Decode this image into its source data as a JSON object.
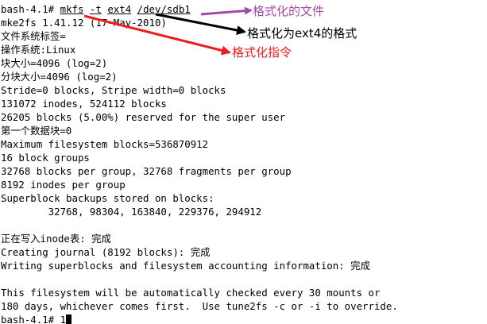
{
  "terminal": {
    "prompt": "bash-4.1# ",
    "command": {
      "program": "mkfs",
      "option": "-t",
      "fstype": "ext4",
      "device": "/dev/sdb1"
    },
    "lines": [
      "mke2fs 1.41.12 (17-May-2010)",
      "文件系统标签=",
      "操作系统:Linux",
      "块大小=4096 (log=2)",
      "分块大小=4096 (log=2)",
      "Stride=0 blocks, Stripe width=0 blocks",
      "131072 inodes, 524112 blocks",
      "26205 blocks (5.00%) reserved for the super user",
      "第一个数据块=0",
      "Maximum filesystem blocks=536870912",
      "16 block groups",
      "32768 blocks per group, 32768 fragments per group",
      "8192 inodes per group",
      "Superblock backups stored on blocks:",
      "        32768, 98304, 163840, 229376, 294912",
      "",
      "正在写入inode表: 完成",
      "Creating journal (8192 blocks): 完成",
      "Writing superblocks and filesystem accounting information: 完成",
      "",
      "This filesystem will be automatically checked every 30 mounts or",
      "180 days, whichever comes first.  Use tune2fs -c or -i to override."
    ],
    "final_prompt": "bash-4.1# ",
    "final_input": "1"
  },
  "annotations": {
    "device_label": "格式化的文件",
    "fstype_label": "格式化为ext4的格式",
    "command_label": "格式化指令"
  },
  "colors": {
    "background": "#ffffff",
    "text": "#000000",
    "purple_arrow": "#a64aa8",
    "black_arrow": "#000000",
    "red_arrow": "#ee1c1c"
  }
}
